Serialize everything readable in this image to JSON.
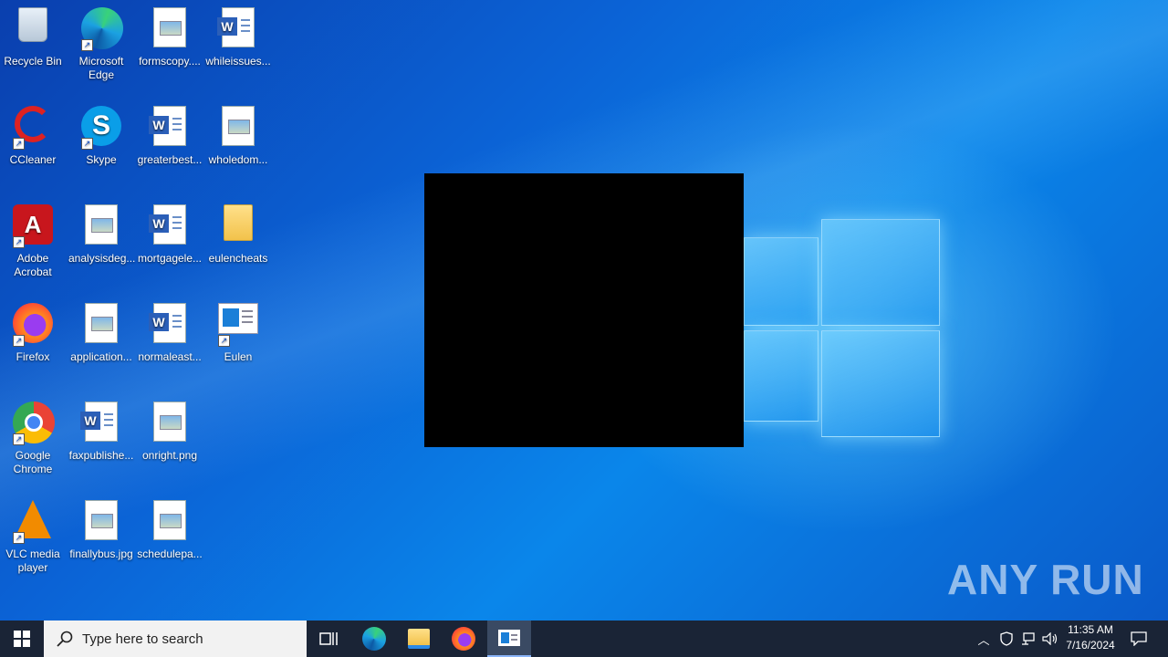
{
  "desktop": {
    "icons": [
      {
        "label": "Recycle Bin"
      },
      {
        "label": "Microsoft Edge"
      },
      {
        "label": "formscopy...."
      },
      {
        "label": "whileissues..."
      },
      {
        "label": "CCleaner"
      },
      {
        "label": "Skype"
      },
      {
        "label": "greaterbest..."
      },
      {
        "label": "wholedom..."
      },
      {
        "label": "Adobe Acrobat"
      },
      {
        "label": "analysisdeg..."
      },
      {
        "label": "mortgagele..."
      },
      {
        "label": "eulencheats"
      },
      {
        "label": "Firefox"
      },
      {
        "label": "application..."
      },
      {
        "label": "normaleast..."
      },
      {
        "label": "Eulen"
      },
      {
        "label": "Google Chrome"
      },
      {
        "label": "faxpublishe..."
      },
      {
        "label": "onright.png"
      },
      {
        "label": "VLC media player"
      },
      {
        "label": "finallybus.jpg"
      },
      {
        "label": "schedulepa..."
      }
    ],
    "watermark": "ANY RUN"
  },
  "taskbar": {
    "search_placeholder": "Type here to search",
    "clock_time": "11:35 AM",
    "clock_date": "7/16/2024"
  },
  "colors": {
    "taskbar": "#1a2436",
    "accent": "#0a78e6"
  }
}
